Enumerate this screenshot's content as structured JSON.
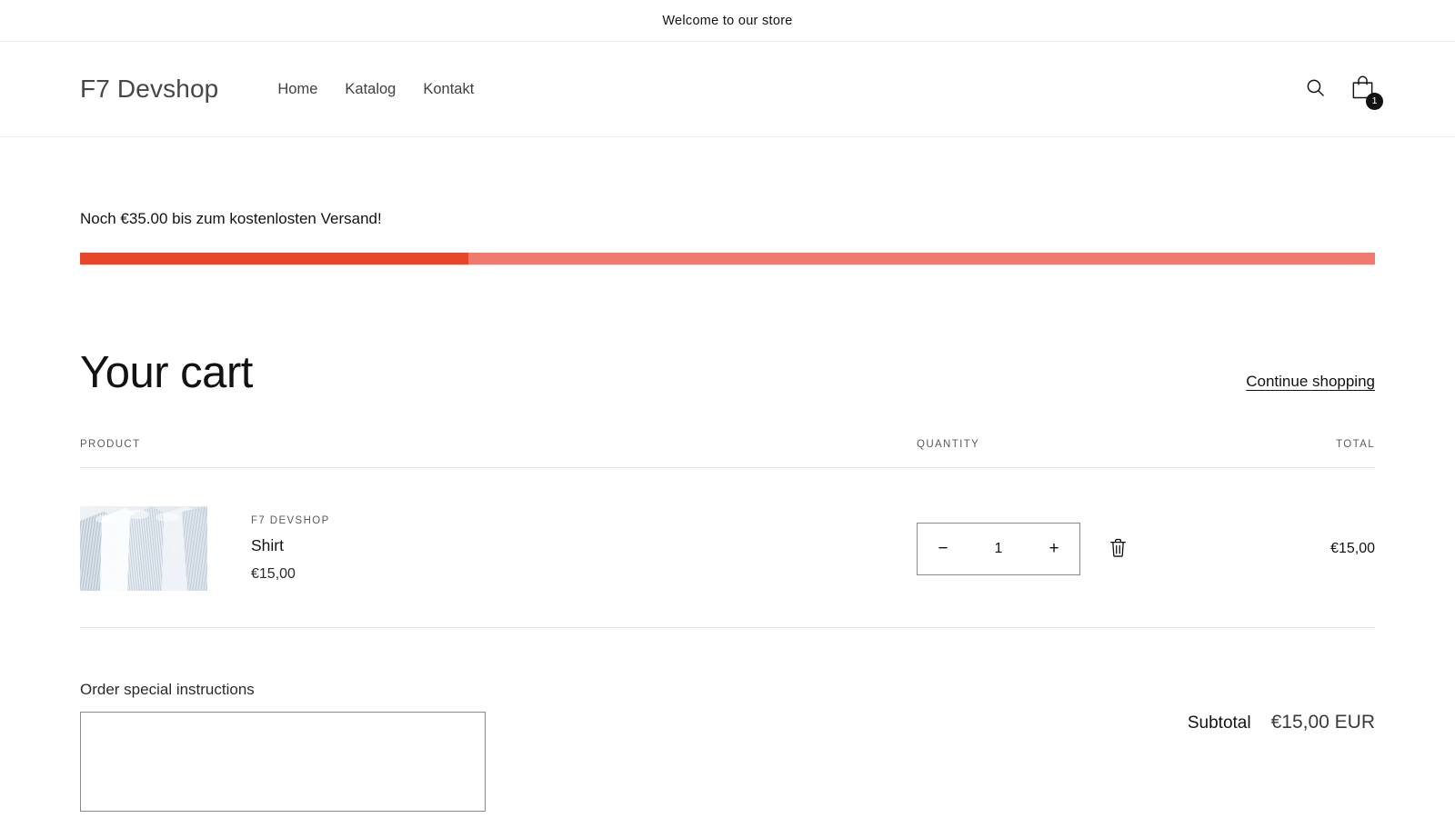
{
  "announcement": {
    "text": "Welcome to our store"
  },
  "header": {
    "brand": "F7 Devshop",
    "nav": [
      {
        "label": "Home"
      },
      {
        "label": "Katalog"
      },
      {
        "label": "Kontakt"
      }
    ],
    "search_icon": "search-icon",
    "cart_icon": "shopping-bag-icon",
    "cart_count": "1"
  },
  "shipping": {
    "message": "Noch €35.00 bis zum kostenlosten Versand!",
    "progress_percent": 30,
    "fill_color": "#e8462a",
    "track_color": "#ef7a6d"
  },
  "cart": {
    "title": "Your cart",
    "continue_shopping": "Continue shopping",
    "columns": {
      "product": "PRODUCT",
      "quantity": "QUANTITY",
      "total": "TOTAL"
    },
    "items": [
      {
        "vendor": "F7 DEVSHOP",
        "title": "Shirt",
        "price": "€15,00",
        "quantity": "1",
        "decrease_label": "−",
        "increase_label": "+",
        "remove_icon": "trash-icon",
        "line_total": "€15,00",
        "image_alt": "Shirt"
      }
    ]
  },
  "footer": {
    "instructions_label": "Order special instructions",
    "instructions_value": "",
    "instructions_placeholder": "",
    "subtotal_label": "Subtotal",
    "subtotal_value": "€15,00 EUR"
  }
}
